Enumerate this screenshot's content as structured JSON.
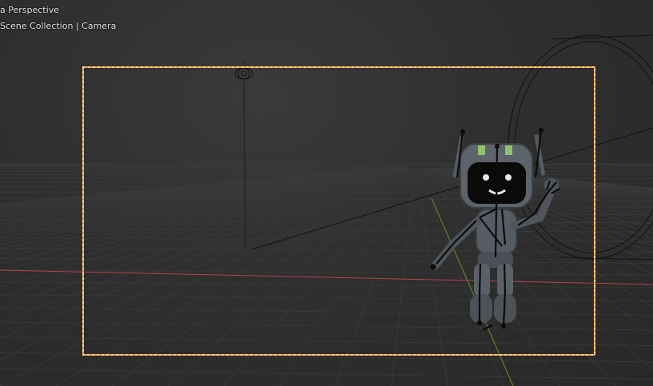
{
  "viewport": {
    "view_mode_label": "a Perspective",
    "collection_label": "Scene Collection | Camera"
  },
  "colors": {
    "background": "#2f2f2f",
    "grid_line": "#3a3a3a",
    "x_axis": "#b5424e",
    "y_axis": "#6b8f2e",
    "camera_frame": "#f0a040",
    "camera_frame_dash": "#ffffff",
    "bone": "#0c0c0c",
    "robot_body": "#5d636a",
    "robot_screen": "#0a0a0a",
    "robot_accent": "#8fc46a"
  },
  "objects": {
    "camera_frame": "camera-view-frame",
    "light": "light-icon",
    "robot": "robot-character",
    "armature": "armature-bones"
  }
}
